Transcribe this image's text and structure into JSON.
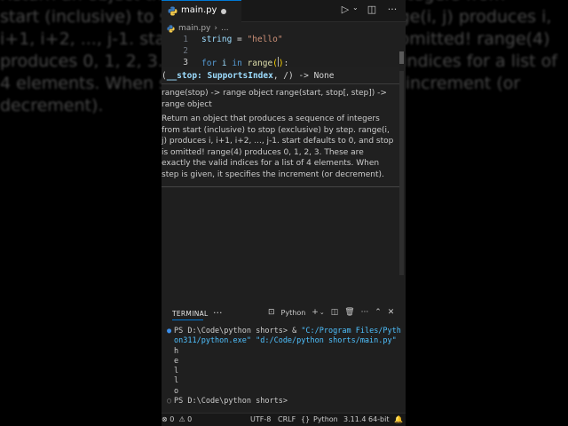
{
  "background_text": "Return an object that produces a sequence of integers from\nstart (inclusive) to stop (exclusive) by step. range(i, j) produces i,\ni+1, i+2, ..., j-1. start defaults to 0, and stop is omitted! range(4)\nproduces 0, 1, 2, 3. These are exactly the valid indices for a list of\n4 elements. When step is given, it specifies the increment (or\ndecrement).",
  "tab": {
    "filename": "main.py"
  },
  "breadcrumb": {
    "file": "main.py",
    "more": "..."
  },
  "editor": {
    "lines": [
      {
        "number": "1",
        "var": "string",
        "op": " = ",
        "str": "\"hello\""
      },
      {
        "number": "2"
      },
      {
        "number": "3",
        "kw_for": "for",
        "var_i": "i",
        "kw_in": "in",
        "fn": "range",
        "open": "(",
        "close": ")",
        "colon": ":"
      }
    ]
  },
  "hover": {
    "signature_open": "(",
    "signature_param": "__stop: SupportsIndex",
    "signature_rest": ", /) -> None",
    "usage": "range(stop) -> range object range(start, stop[, step]) -> range object",
    "description": "Return an object that produces a sequence of integers from start (inclusive) to stop (exclusive) by step. range(i, j) produces i, i+1, i+2, ..., j-1. start defaults to 0, and stop is omitted! range(4) produces 0, 1, 2, 3. These are exactly the valid indices for a list of 4 elements. When step is given, it specifies the increment (or decrement)."
  },
  "terminal": {
    "tab_label": "TERMINAL",
    "more": "···",
    "profile": "Python",
    "prompt1": "PS D:\\Code\\python shorts> ",
    "cmd_amp": "& ",
    "cmd_exe": "\"C:/Program Files/Python311/python.exe\" \"d:/Code/python shorts/main.py\"",
    "output": [
      "h",
      "e",
      "l",
      "l",
      "o"
    ],
    "prompt2": "PS D:\\Code\\python shorts>"
  },
  "status": {
    "errors": "0",
    "warnings": "0",
    "encoding": "UTF-8",
    "eol": "CRLF",
    "language": "Python",
    "interpreter": "3.11.4 64-bit"
  },
  "colors": {
    "accent": "#0078d4",
    "background": "#1f1f1f"
  }
}
